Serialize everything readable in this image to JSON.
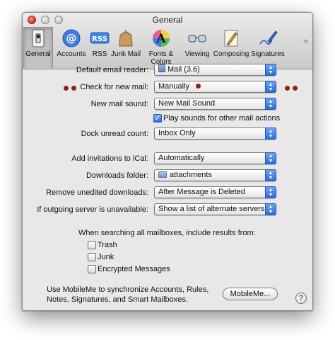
{
  "window": {
    "title": "General"
  },
  "toolbar": {
    "items": [
      {
        "label": "General",
        "icon": "general-switch-icon"
      },
      {
        "label": "Accounts",
        "icon": "at-sign-icon"
      },
      {
        "label": "RSS",
        "icon": "rss-badge-icon",
        "badge": "RSS"
      },
      {
        "label": "Junk Mail",
        "icon": "junk-mail-bag-icon"
      },
      {
        "label": "Fonts & Colors",
        "icon": "fonts-colors-icon",
        "glyph": "A"
      },
      {
        "label": "Viewing",
        "icon": "viewing-glasses-icon"
      },
      {
        "label": "Composing",
        "icon": "composing-pencil-icon"
      },
      {
        "label": "Signatures",
        "icon": "signature-pen-icon"
      }
    ],
    "more_glyph": "»"
  },
  "settings": {
    "default_reader_label": "Default email reader:",
    "default_reader_value": "Mail (3.6)",
    "check_mail_label": "Check for new mail:",
    "check_mail_value": "Manually",
    "new_mail_sound_label": "New mail sound:",
    "new_mail_sound_value": "New Mail Sound",
    "play_sounds_label": "Play sounds for other mail actions",
    "play_sounds_checked": true,
    "dock_unread_label": "Dock unread count:",
    "dock_unread_value": "Inbox Only",
    "add_invitations_label": "Add invitations to iCal:",
    "add_invitations_value": "Automatically",
    "downloads_folder_label": "Downloads folder:",
    "downloads_folder_value": "attachments",
    "remove_downloads_label": "Remove unedited downloads:",
    "remove_downloads_value": "After Message is Deleted",
    "outgoing_server_label": "If outgoing server is unavailable:",
    "outgoing_server_value": "Show a list of alternate servers"
  },
  "search": {
    "heading": "When searching all mailboxes, include results from:",
    "options": [
      {
        "label": "Trash",
        "checked": false
      },
      {
        "label": "Junk",
        "checked": false
      },
      {
        "label": "Encrypted Messages",
        "checked": false
      }
    ]
  },
  "mobileme": {
    "text_line1": "Use MobileMe to synchronize Accounts, Rules,",
    "text_line2": "Notes, Signatures, and Smart Mailboxes.",
    "button_label": "MobileMe...",
    "help_glyph": "?"
  },
  "colors": {
    "accent_blue": "#2d6de2",
    "annotation_dot": "#8a2413"
  }
}
